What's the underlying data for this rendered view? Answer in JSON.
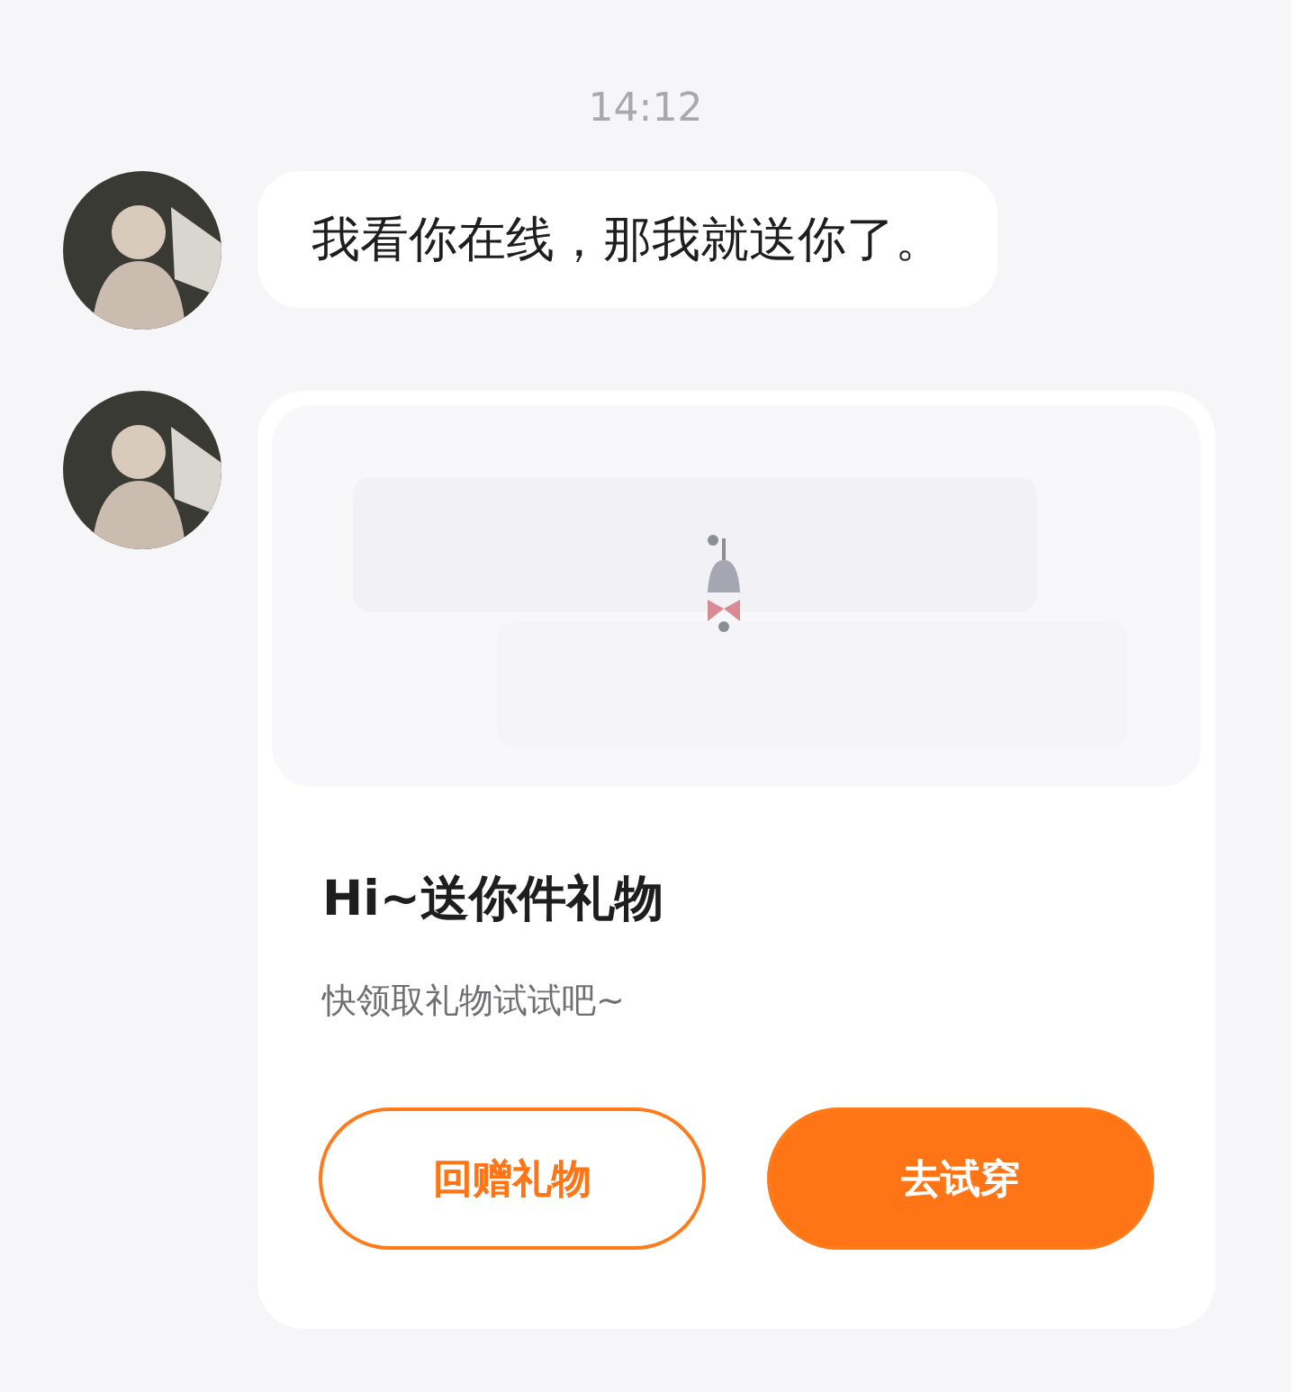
{
  "timestamp": "14:12",
  "messages": [
    {
      "kind": "text",
      "text": "我看你在线，那我就送你了。"
    },
    {
      "kind": "gift",
      "title": "Hi~送你件礼物",
      "subtitle": "快领取礼物试试吧~",
      "buttons": [
        {
          "label": "回赠礼物",
          "kind": "outline"
        },
        {
          "label": "去试穿",
          "kind": "primary"
        }
      ]
    }
  ]
}
